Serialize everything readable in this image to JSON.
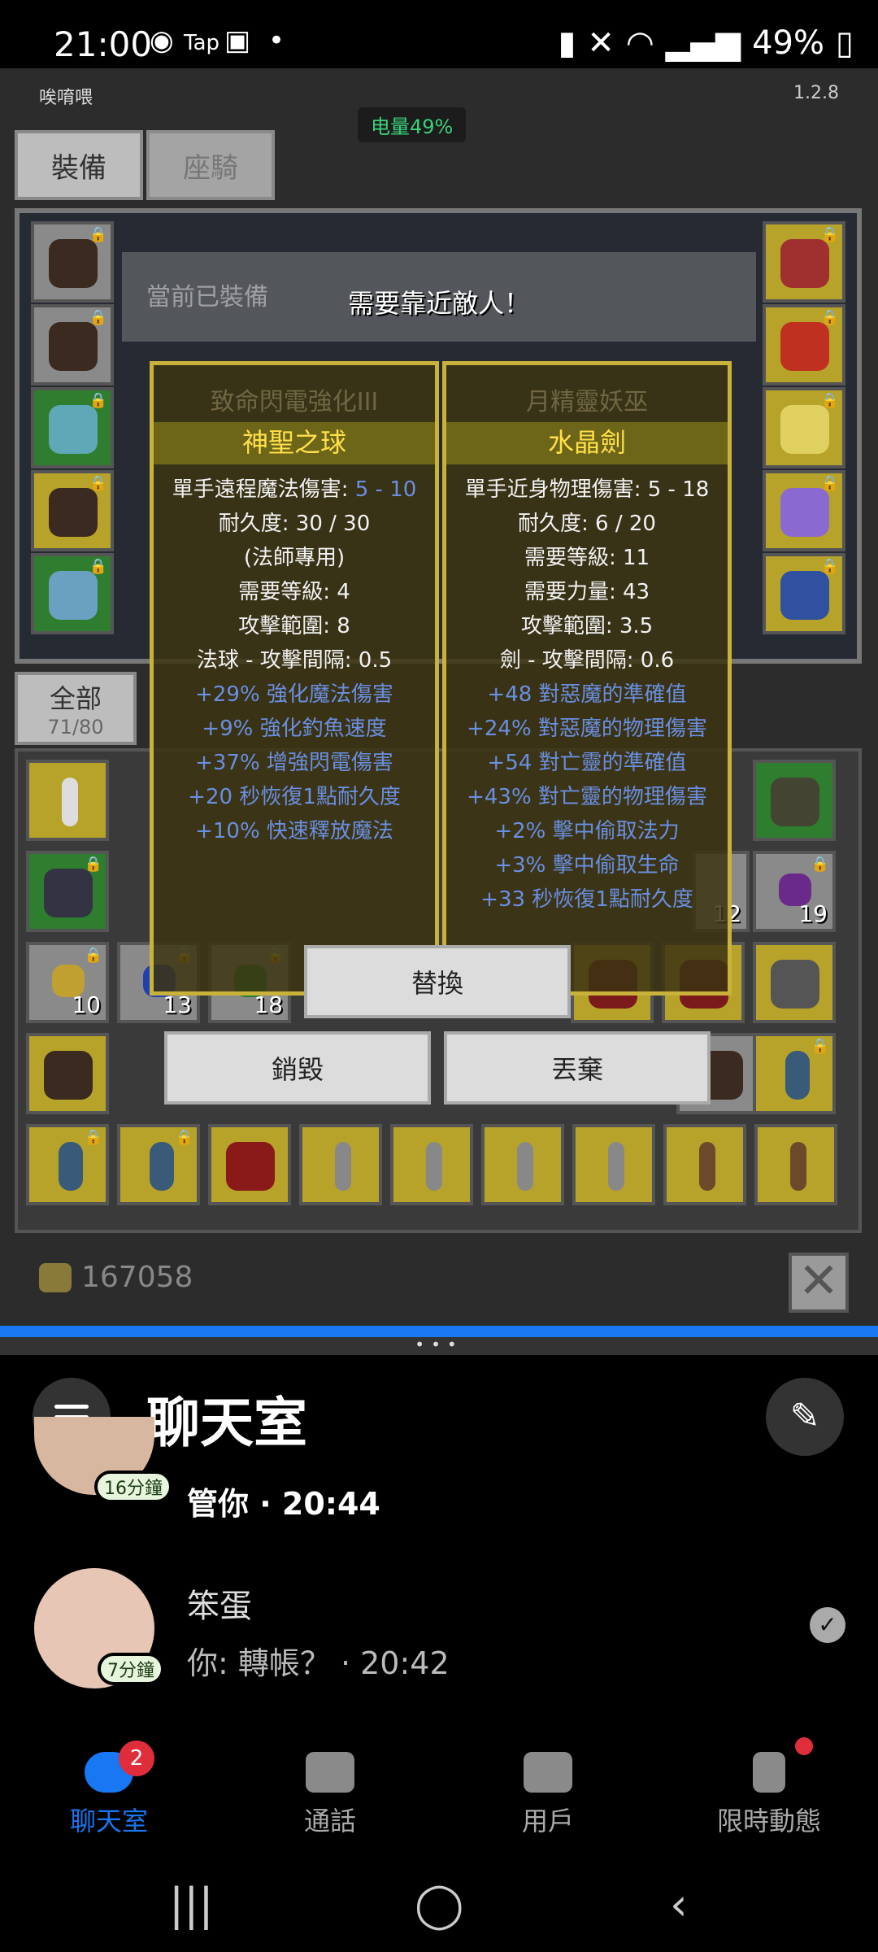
{
  "status_bar": {
    "time": "21:00",
    "battery": "49%"
  },
  "game": {
    "app_name": "唉唷喂",
    "version": "1.2.8",
    "battery_label": "电量49%",
    "tabs": [
      "裝備",
      "座騎"
    ],
    "equipped_label": "當前已裝備",
    "need_close": "需要靠近敵人！",
    "left_item": {
      "ghost_title": "致命閃電強化III",
      "name": "神聖之球",
      "line1_prefix": "單手遠程魔法傷害: ",
      "line1_range": "5 - 10",
      "lines": [
        "耐久度: 30 / 30",
        "(法師專用)",
        "需要等級: 4",
        "攻擊範圍: 8",
        "法球 - 攻擊間隔: 0.5"
      ],
      "bonuses": [
        "+29% 強化魔法傷害",
        "+9% 強化釣魚速度",
        "+37% 增強閃電傷害",
        "+20 秒恢復1點耐久度",
        "+10% 快速釋放魔法"
      ]
    },
    "right_item": {
      "ghost_title": "月精靈妖巫",
      "name": "水晶劍",
      "lines": [
        "單手近身物理傷害: 5 - 18",
        "耐久度: 6 / 20",
        "需要等級: 11",
        "需要力量: 43",
        "攻擊範圍: 3.5",
        "劍 - 攻擊間隔: 0.6"
      ],
      "bonuses": [
        "+48 對惡魔的準確值",
        "+24% 對惡魔的物理傷害",
        "+54 對亡靈的準確值",
        "+43% 對亡靈的物理傷害",
        "+2% 擊中偷取法力",
        "+3% 擊中偷取生命",
        "+33 秒恢復1點耐久度"
      ]
    },
    "buttons": {
      "replace": "替換",
      "destroy": "銷毀",
      "discard": "丟棄"
    },
    "all_tab": {
      "label": "全部",
      "count": "71/80"
    },
    "counts": [
      "10",
      "13",
      "18",
      "12",
      "19"
    ],
    "gold": "167058"
  },
  "chat": {
    "title": "聊天室",
    "rows": [
      {
        "name": "管你 · 20:44",
        "badge": "16分鐘"
      },
      {
        "name": "笨蛋",
        "message": "你: 轉帳？ · 20:42",
        "badge": "7分鐘"
      }
    ],
    "nav": [
      {
        "label": "聊天室",
        "badge": "2"
      },
      {
        "label": "通話"
      },
      {
        "label": "用戶"
      },
      {
        "label": "限時動態"
      }
    ]
  }
}
